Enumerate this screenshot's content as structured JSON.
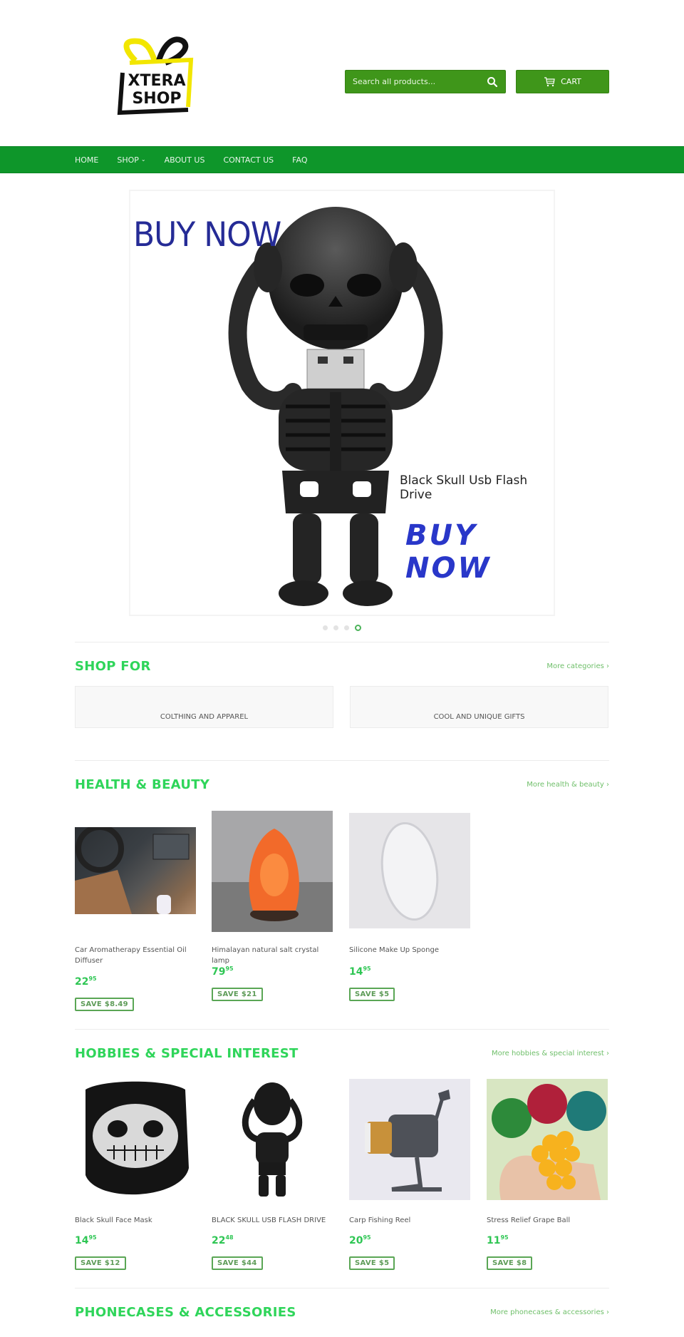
{
  "header": {
    "logo": {
      "line1": "XTERA",
      "line2": "SHOP",
      "bow_colors": [
        "#f2e600",
        "#000000"
      ]
    },
    "search": {
      "placeholder": "Search all products...",
      "value": "",
      "icon": "search-icon"
    },
    "cart": {
      "label": "CART",
      "icon": "cart-icon"
    }
  },
  "nav": {
    "items": [
      {
        "label": "HOME"
      },
      {
        "label": "SHOP",
        "icon": "chevron-down-icon",
        "chevron": "⌄"
      },
      {
        "label": "ABOUT US"
      },
      {
        "label": "CONTACT US"
      },
      {
        "label": "FAQ"
      }
    ]
  },
  "slideshow": {
    "heading_top": "BUY NOW",
    "caption": "Black Skull Usb Flash Drive",
    "heading_bottom": "BUY NOW",
    "slide_count": 4,
    "active_slide": 4
  },
  "shop_for": {
    "title": "SHOP FOR",
    "more_link": "More categories ›",
    "collections": [
      {
        "label": "COLTHING AND APPAREL"
      },
      {
        "label": "COOL AND UNIQUE GIFTS"
      }
    ]
  },
  "health_beauty": {
    "title": "HEALTH & BEAUTY",
    "more_link": "More health & beauty ›",
    "products": [
      {
        "name": "Car Aromatherapy Essential Oil Diffuser",
        "price_whole": "22",
        "price_cents": "95",
        "save": "SAVE $8.49",
        "image": "car-diffuser-image"
      },
      {
        "name": "Himalayan natural salt crystal lamp",
        "price_whole": "79",
        "price_cents": "95",
        "save": "SAVE $21",
        "image": "salt-lamp-image"
      },
      {
        "name": "Silicone Make Up Sponge",
        "price_whole": "14",
        "price_cents": "95",
        "save": "SAVE $5",
        "image": "silicone-sponge-image"
      }
    ]
  },
  "hobbies": {
    "title": "HOBBIES & SPECIAL INTEREST",
    "more_link": "More hobbies & special interest ›",
    "products": [
      {
        "name": "Black Skull Face Mask",
        "price_whole": "14",
        "price_cents": "95",
        "save": "SAVE $12",
        "image": "skull-mask-image"
      },
      {
        "name": "BLACK SKULL USB FLASH DRIVE",
        "price_whole": "22",
        "price_cents": "48",
        "save": "SAVE $44",
        "image": "skull-usb-image"
      },
      {
        "name": "Carp Fishing Reel",
        "price_whole": "20",
        "price_cents": "95",
        "save": "SAVE $5",
        "image": "fishing-reel-image"
      },
      {
        "name": "Stress Relief Grape Ball",
        "price_whole": "11",
        "price_cents": "95",
        "save": "SAVE $8",
        "image": "grape-ball-image"
      }
    ]
  },
  "phonecases": {
    "title": "PHONECASES & ACCESSORIES",
    "more_link": "More phonecases & accessories ›"
  },
  "colors": {
    "header_green": "#3f961a",
    "nav_green": "#0e962a",
    "section_title_green": "#2fd55a",
    "price_green": "#2fc654",
    "save_border": "#5aa655"
  }
}
